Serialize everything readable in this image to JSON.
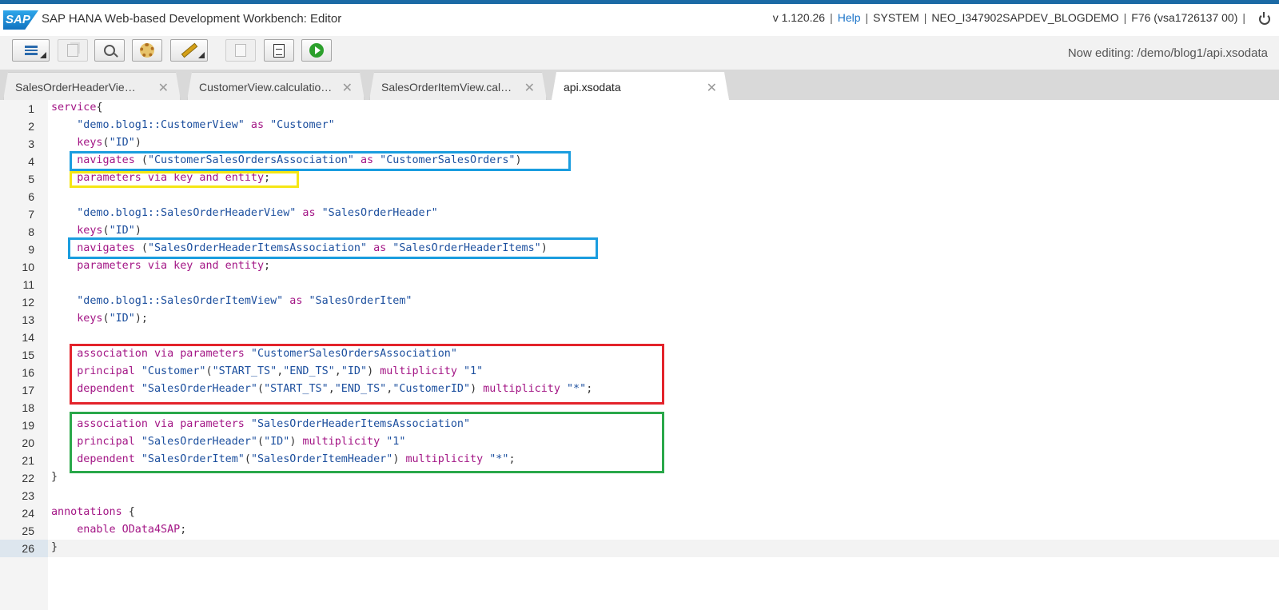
{
  "header": {
    "logo_text": "SAP",
    "title": "SAP HANA Web-based Development Workbench: Editor",
    "version": "v 1.120.26",
    "help": "Help",
    "user": "SYSTEM",
    "account": "NEO_I347902SAPDEV_BLOGDEMO",
    "system": "F76 (vsa1726137 00)"
  },
  "toolbar": {
    "now_editing": "Now editing: /demo/blog1/api.xsodata",
    "icons": [
      "menu-icon",
      "copy-icon",
      "search-icon",
      "gear-icon",
      "wand-icon",
      "save-icon",
      "document-icon",
      "run-icon"
    ]
  },
  "tabs": [
    {
      "label": "SalesOrderHeaderView.calculationview",
      "active": false
    },
    {
      "label": "CustomerView.calculationview",
      "active": false
    },
    {
      "label": "SalesOrderItemView.calculationview",
      "active": false
    },
    {
      "label": "api.xsodata",
      "active": true
    }
  ],
  "tab_close": "✕",
  "colors": {
    "keyword": "#a31585",
    "string": "#1c4f9e",
    "blue_box": "#1a9ddf",
    "yellow_box": "#f5e614",
    "red_box": "#e3232b",
    "green_box": "#2aa84a"
  },
  "code": {
    "current_line": 26,
    "lines": [
      {
        "n": "1",
        "tokens": [
          [
            "kw",
            "service"
          ],
          [
            "pl",
            "{"
          ]
        ]
      },
      {
        "n": "2",
        "tokens": [
          [
            "pl",
            "    "
          ],
          [
            "str",
            "\"demo.blog1::CustomerView\""
          ],
          [
            "pl",
            " "
          ],
          [
            "kw",
            "as"
          ],
          [
            "pl",
            " "
          ],
          [
            "str",
            "\"Customer\""
          ]
        ]
      },
      {
        "n": "3",
        "tokens": [
          [
            "pl",
            "    "
          ],
          [
            "kw",
            "keys"
          ],
          [
            "pl",
            "("
          ],
          [
            "str",
            "\"ID\""
          ],
          [
            "pl",
            ")"
          ]
        ]
      },
      {
        "n": "4",
        "tokens": [
          [
            "pl",
            "    "
          ],
          [
            "kw",
            "navigates"
          ],
          [
            "pl",
            " ("
          ],
          [
            "str",
            "\"CustomerSalesOrdersAssociation\""
          ],
          [
            "pl",
            " "
          ],
          [
            "kw",
            "as"
          ],
          [
            "pl",
            " "
          ],
          [
            "str",
            "\"CustomerSalesOrders\""
          ],
          [
            "pl",
            ")"
          ]
        ]
      },
      {
        "n": "5",
        "tokens": [
          [
            "pl",
            "    "
          ],
          [
            "kw",
            "parameters via key and entity"
          ],
          [
            "pl",
            ";"
          ]
        ]
      },
      {
        "n": "6",
        "tokens": []
      },
      {
        "n": "7",
        "tokens": [
          [
            "pl",
            "    "
          ],
          [
            "str",
            "\"demo.blog1::SalesOrderHeaderView\""
          ],
          [
            "pl",
            " "
          ],
          [
            "kw",
            "as"
          ],
          [
            "pl",
            " "
          ],
          [
            "str",
            "\"SalesOrderHeader\""
          ]
        ]
      },
      {
        "n": "8",
        "tokens": [
          [
            "pl",
            "    "
          ],
          [
            "kw",
            "keys"
          ],
          [
            "pl",
            "("
          ],
          [
            "str",
            "\"ID\""
          ],
          [
            "pl",
            ")"
          ]
        ]
      },
      {
        "n": "9",
        "tokens": [
          [
            "pl",
            "    "
          ],
          [
            "kw",
            "navigates"
          ],
          [
            "pl",
            " ("
          ],
          [
            "str",
            "\"SalesOrderHeaderItemsAssociation\""
          ],
          [
            "pl",
            " "
          ],
          [
            "kw",
            "as"
          ],
          [
            "pl",
            " "
          ],
          [
            "str",
            "\"SalesOrderHeaderItems\""
          ],
          [
            "pl",
            ")"
          ]
        ]
      },
      {
        "n": "10",
        "tokens": [
          [
            "pl",
            "    "
          ],
          [
            "kw",
            "parameters via key and entity"
          ],
          [
            "pl",
            ";"
          ]
        ]
      },
      {
        "n": "11",
        "tokens": []
      },
      {
        "n": "12",
        "tokens": [
          [
            "pl",
            "    "
          ],
          [
            "str",
            "\"demo.blog1::SalesOrderItemView\""
          ],
          [
            "pl",
            " "
          ],
          [
            "kw",
            "as"
          ],
          [
            "pl",
            " "
          ],
          [
            "str",
            "\"SalesOrderItem\""
          ]
        ]
      },
      {
        "n": "13",
        "tokens": [
          [
            "pl",
            "    "
          ],
          [
            "kw",
            "keys"
          ],
          [
            "pl",
            "("
          ],
          [
            "str",
            "\"ID\""
          ],
          [
            "pl",
            ");"
          ]
        ]
      },
      {
        "n": "14",
        "tokens": []
      },
      {
        "n": "15",
        "tokens": [
          [
            "pl",
            "    "
          ],
          [
            "kw",
            "association via parameters"
          ],
          [
            "pl",
            " "
          ],
          [
            "str",
            "\"CustomerSalesOrdersAssociation\""
          ]
        ]
      },
      {
        "n": "16",
        "tokens": [
          [
            "pl",
            "    "
          ],
          [
            "kw",
            "principal"
          ],
          [
            "pl",
            " "
          ],
          [
            "str",
            "\"Customer\""
          ],
          [
            "pl",
            "("
          ],
          [
            "str",
            "\"START_TS\""
          ],
          [
            "pl",
            ","
          ],
          [
            "str",
            "\"END_TS\""
          ],
          [
            "pl",
            ","
          ],
          [
            "str",
            "\"ID\""
          ],
          [
            "pl",
            ") "
          ],
          [
            "kw",
            "multiplicity"
          ],
          [
            "pl",
            " "
          ],
          [
            "str",
            "\"1\""
          ]
        ]
      },
      {
        "n": "17",
        "tokens": [
          [
            "pl",
            "    "
          ],
          [
            "kw",
            "dependent"
          ],
          [
            "pl",
            " "
          ],
          [
            "str",
            "\"SalesOrderHeader\""
          ],
          [
            "pl",
            "("
          ],
          [
            "str",
            "\"START_TS\""
          ],
          [
            "pl",
            ","
          ],
          [
            "str",
            "\"END_TS\""
          ],
          [
            "pl",
            ","
          ],
          [
            "str",
            "\"CustomerID\""
          ],
          [
            "pl",
            ") "
          ],
          [
            "kw",
            "multiplicity"
          ],
          [
            "pl",
            " "
          ],
          [
            "str",
            "\"*\""
          ],
          [
            "pl",
            ";"
          ]
        ]
      },
      {
        "n": "18",
        "tokens": []
      },
      {
        "n": "19",
        "tokens": [
          [
            "pl",
            "    "
          ],
          [
            "kw",
            "association via parameters"
          ],
          [
            "pl",
            " "
          ],
          [
            "str",
            "\"SalesOrderHeaderItemsAssociation\""
          ]
        ]
      },
      {
        "n": "20",
        "tokens": [
          [
            "pl",
            "    "
          ],
          [
            "kw",
            "principal"
          ],
          [
            "pl",
            " "
          ],
          [
            "str",
            "\"SalesOrderHeader\""
          ],
          [
            "pl",
            "("
          ],
          [
            "str",
            "\"ID\""
          ],
          [
            "pl",
            ") "
          ],
          [
            "kw",
            "multiplicity"
          ],
          [
            "pl",
            " "
          ],
          [
            "str",
            "\"1\""
          ]
        ]
      },
      {
        "n": "21",
        "tokens": [
          [
            "pl",
            "    "
          ],
          [
            "kw",
            "dependent"
          ],
          [
            "pl",
            " "
          ],
          [
            "str",
            "\"SalesOrderItem\""
          ],
          [
            "pl",
            "("
          ],
          [
            "str",
            "\"SalesOrderItemHeader\""
          ],
          [
            "pl",
            ") "
          ],
          [
            "kw",
            "multiplicity"
          ],
          [
            "pl",
            " "
          ],
          [
            "str",
            "\"*\""
          ],
          [
            "pl",
            ";"
          ]
        ]
      },
      {
        "n": "22",
        "tokens": [
          [
            "pl",
            "}"
          ]
        ]
      },
      {
        "n": "23",
        "tokens": []
      },
      {
        "n": "24",
        "tokens": [
          [
            "kw",
            "annotations"
          ],
          [
            "pl",
            " {"
          ]
        ]
      },
      {
        "n": "25",
        "tokens": [
          [
            "pl",
            "    "
          ],
          [
            "kw",
            "enable OData4SAP"
          ],
          [
            "pl",
            ";"
          ]
        ]
      },
      {
        "n": "26",
        "tokens": [
          [
            "pl",
            "}"
          ]
        ]
      }
    ]
  }
}
